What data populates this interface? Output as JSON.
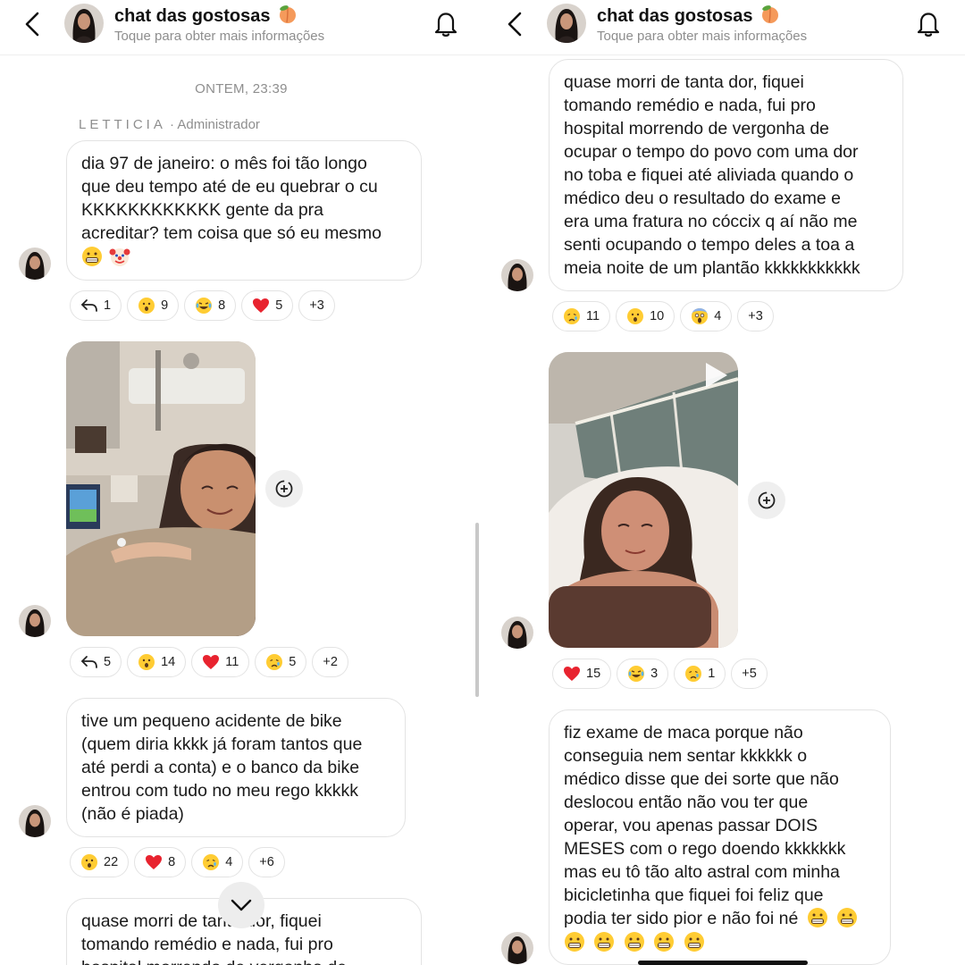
{
  "screens": [
    {
      "header": {
        "title": "chat das gostosas",
        "title_emoji": "peach",
        "subtitle": "Toque para obter mais informações"
      },
      "timestamp": "ONTEM, 23:39",
      "sender": {
        "name": "LETTICIA",
        "role": "· Administrador"
      },
      "messages": [
        {
          "type": "text",
          "lines": [
            "dia 97 de janeiro: o mês foi tão longo",
            "que deu tempo até de eu quebrar o cu",
            "KKKKKKKKKKKK gente da pra",
            "acreditar? tem coisa que só eu mesmo"
          ],
          "trailing_emojis": [
            "grimacing-face",
            "clown-face"
          ],
          "reactions": [
            {
              "icon": "reply-icon",
              "count": "1"
            },
            {
              "icon": "surprised-face",
              "count": "9"
            },
            {
              "icon": "laughing-face",
              "count": "8"
            },
            {
              "icon": "red-heart",
              "count": "5"
            },
            {
              "icon": "",
              "count": "+3"
            }
          ]
        },
        {
          "type": "photo",
          "description": "selfie in hospital bed",
          "reactions": [
            {
              "icon": "reply-icon",
              "count": "5"
            },
            {
              "icon": "surprised-face",
              "count": "14"
            },
            {
              "icon": "red-heart",
              "count": "11"
            },
            {
              "icon": "crying-face",
              "count": "5"
            },
            {
              "icon": "",
              "count": "+2"
            }
          ]
        },
        {
          "type": "text",
          "lines": [
            "tive um pequeno acidente de bike",
            "(quem diria kkkk já foram tantos que",
            "até perdi a conta) e o banco da bike",
            "entrou com tudo no meu rego kkkkk",
            "(não é piada)"
          ],
          "reactions": [
            {
              "icon": "surprised-face",
              "count": "22"
            },
            {
              "icon": "red-heart",
              "count": "8"
            },
            {
              "icon": "crying-face",
              "count": "4"
            },
            {
              "icon": "",
              "count": "+6"
            }
          ]
        },
        {
          "type": "text",
          "lines": [
            "quase morri de tanta dor, fiquei",
            "tomando remédio e nada, fui pro",
            "hospital morrendo de vergonha de"
          ]
        }
      ]
    },
    {
      "header": {
        "title": "chat das gostosas",
        "title_emoji": "peach",
        "subtitle": "Toque para obter mais informações"
      },
      "messages": [
        {
          "type": "text",
          "lines": [
            "quase morri de tanta dor, fiquei",
            "tomando remédio e nada, fui pro",
            "hospital morrendo de vergonha de",
            "ocupar o tempo do povo com uma dor",
            "no toba e fiquei até aliviada quando o",
            "médico deu o resultado do exame e",
            "era uma fratura no cóccix q aí não me",
            "senti ocupando o tempo deles a toa a",
            "meia noite de um plantão kkkkkkkkkkk"
          ],
          "reactions": [
            {
              "icon": "crying-face",
              "count": "11"
            },
            {
              "icon": "surprised-face",
              "count": "10"
            },
            {
              "icon": "screaming-face",
              "count": "4"
            },
            {
              "icon": "",
              "count": "+3"
            }
          ]
        },
        {
          "type": "video",
          "description": "video of woman lying on hospital stretcher",
          "reactions": [
            {
              "icon": "red-heart",
              "count": "15"
            },
            {
              "icon": "laughing-face",
              "count": "3"
            },
            {
              "icon": "crying-face",
              "count": "1"
            },
            {
              "icon": "",
              "count": "+5"
            }
          ]
        },
        {
          "type": "text",
          "lines": [
            "fiz exame de maca porque não",
            "conseguia nem sentar kkkkkk o",
            "médico disse que dei sorte que não",
            "deslocou então não vou ter que",
            "operar, vou apenas passar DOIS",
            "MESES com o rego doendo kkkkkkk",
            "mas eu tô tão alto astral com minha",
            "bicicletinha que fiquei foi feliz que",
            "podia ter sido pior e não foi né"
          ],
          "trailing_emojis": [
            "grimacing-face",
            "grimacing-face",
            "grimacing-face",
            "grimacing-face",
            "grimacing-face",
            "grimacing-face",
            "grimacing-face"
          ]
        }
      ]
    }
  ]
}
